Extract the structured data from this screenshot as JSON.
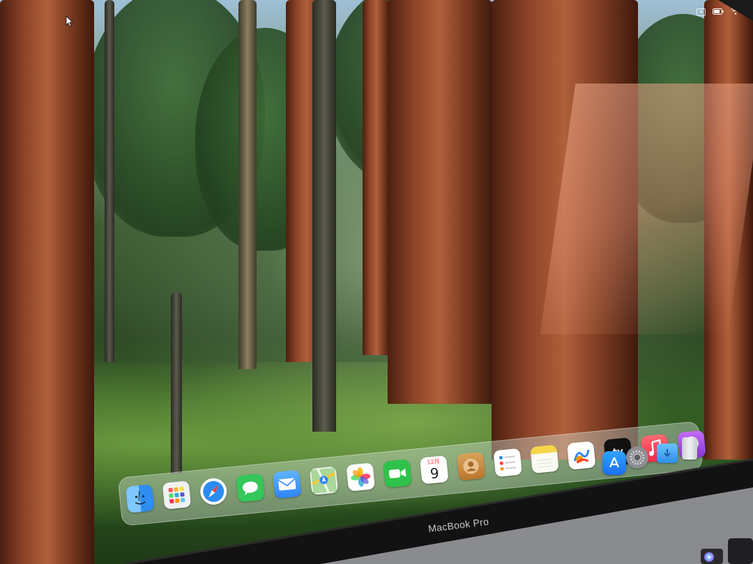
{
  "menubar": {
    "items": [
      {
        "name": "input-source-icon",
        "label": "A"
      },
      {
        "name": "battery-icon",
        "label": ""
      },
      {
        "name": "wifi-icon",
        "label": ""
      }
    ]
  },
  "dock": {
    "apps": [
      {
        "name": "finder",
        "icon": "finder-icon",
        "color": "#2f8ef0"
      },
      {
        "name": "launchpad",
        "icon": "launchpad-icon",
        "color": "#f1f1f1"
      },
      {
        "name": "safari",
        "icon": "safari-icon",
        "color": "#2a8cf0"
      },
      {
        "name": "messages",
        "icon": "messages-icon",
        "color": "#34c759"
      },
      {
        "name": "mail",
        "icon": "mail-icon",
        "color": "#2f86f5"
      },
      {
        "name": "maps",
        "icon": "maps-icon",
        "color": "#6fc07a"
      },
      {
        "name": "photos",
        "icon": "photos-icon",
        "color": "#ffffff"
      },
      {
        "name": "facetime",
        "icon": "facetime-icon",
        "color": "#2fc24a"
      },
      {
        "name": "calendar",
        "icon": "calendar-icon",
        "color": "#ffffff",
        "month": "12月",
        "day": "9"
      },
      {
        "name": "contacts",
        "icon": "contacts-icon",
        "color": "#c98a42"
      },
      {
        "name": "reminders",
        "icon": "reminders-icon",
        "color": "#ffffff"
      },
      {
        "name": "notes",
        "icon": "notes-icon",
        "color": "#f7d64c"
      },
      {
        "name": "freeform",
        "icon": "freeform-icon",
        "color": "#ffffff"
      },
      {
        "name": "apple-tv",
        "icon": "apple-tv-icon",
        "color": "#111111",
        "label": "tv"
      },
      {
        "name": "music",
        "icon": "music-icon",
        "color": "#f94c57"
      },
      {
        "name": "podcasts",
        "icon": "podcasts-icon",
        "color": "#9b4de0"
      },
      {
        "name": "app-store",
        "icon": "app-store-icon",
        "color": "#1c8cf2"
      },
      {
        "name": "system-settings",
        "icon": "gear-icon",
        "color": "#8e8e93"
      },
      {
        "name": "downloads-folder",
        "icon": "folder-icon",
        "color": "#3aa0f0"
      },
      {
        "name": "trash",
        "icon": "trash-icon",
        "color": "#d9dde0"
      }
    ]
  },
  "device": {
    "brand_label": "MacBook Pro"
  }
}
